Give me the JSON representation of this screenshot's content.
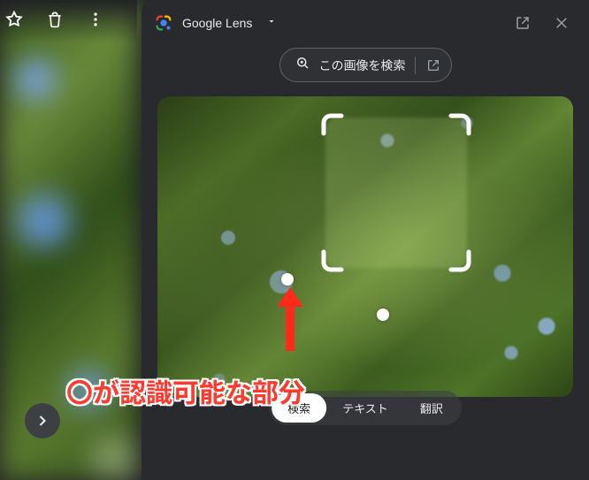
{
  "header": {
    "title": "Google Lens",
    "search_image_label": "この画像を検索"
  },
  "segments": {
    "search": "検索",
    "text": "テキスト",
    "translate": "翻訳"
  },
  "annotation": "〇が認識可能な部分",
  "icons": {
    "star": "star-icon",
    "trash": "trash-icon",
    "more": "more-icon",
    "lens_logo": "google-lens-logo-icon",
    "caret": "chevron-down-icon",
    "open_new": "open-in-new-icon",
    "close": "close-icon",
    "lens_small": "lens-search-icon",
    "chevron_right": "chevron-right-icon"
  }
}
